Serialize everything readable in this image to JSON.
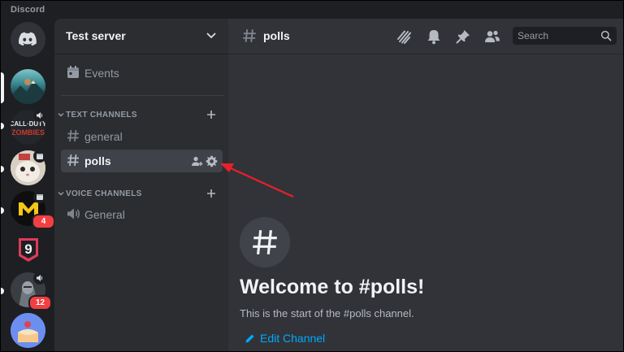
{
  "app": {
    "title": "Discord"
  },
  "colors": {
    "arrow": "#e8202a",
    "link": "#00a8fc",
    "badge": "#f23f43",
    "blurple": "#5865f2"
  },
  "rail": {
    "servers": [
      {
        "name": "server-1",
        "icon": "mountain-server-icon"
      },
      {
        "name": "server-2",
        "icon": "call-of-duty-zombies-icon",
        "status_icon": "speaker-icon"
      },
      {
        "name": "server-3",
        "icon": "cat-server-icon",
        "status_icon": "event-icon"
      },
      {
        "name": "server-4",
        "icon": "m-logo-server-icon",
        "status_icon": "event-icon",
        "badge": "4"
      },
      {
        "name": "server-5",
        "icon": "number-9-server-icon"
      },
      {
        "name": "server-6",
        "icon": "armored-character-icon",
        "status_icon": "speaker-icon",
        "badge": "12"
      },
      {
        "name": "server-7",
        "icon": "cake-avatar-icon"
      }
    ]
  },
  "sidebar": {
    "server_name": "Test server",
    "events_label": "Events",
    "text_category": "TEXT CHANNELS",
    "text_channels": [
      "general",
      "polls"
    ],
    "voice_category": "VOICE CHANNELS",
    "voice_channels": [
      "General"
    ]
  },
  "header": {
    "channel": "polls",
    "search_placeholder": "Search"
  },
  "welcome": {
    "title": "Welcome to #polls!",
    "subtitle": "This is the start of the #polls channel.",
    "edit_label": "Edit Channel"
  }
}
